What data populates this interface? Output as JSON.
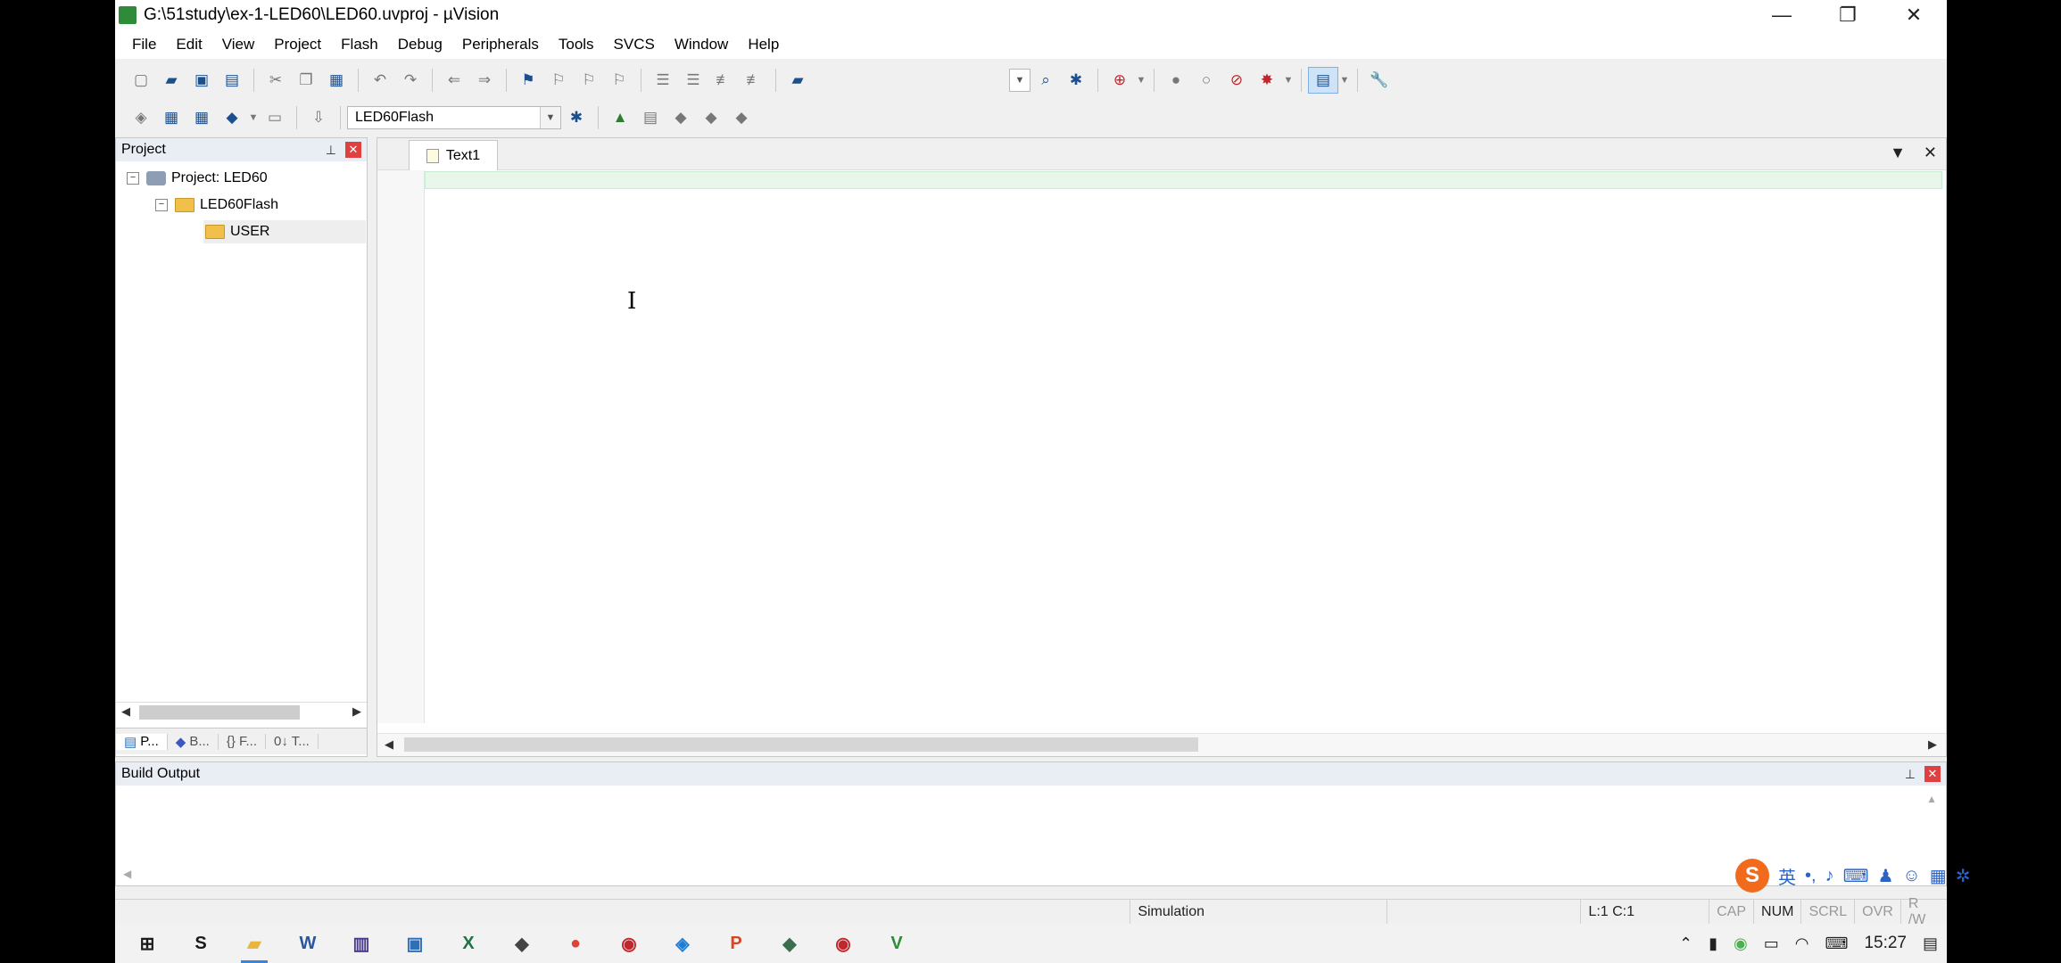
{
  "window": {
    "title": "G:\\51study\\ex-1-LED60\\LED60.uvproj - µVision",
    "controls": {
      "minimize": "—",
      "restore": "❐",
      "close": "✕"
    }
  },
  "menu": [
    "File",
    "Edit",
    "View",
    "Project",
    "Flash",
    "Debug",
    "Peripherals",
    "Tools",
    "SVCS",
    "Window",
    "Help"
  ],
  "toolbar2": {
    "target_select": "LED60Flash"
  },
  "project_panel": {
    "title": "Project",
    "tree": {
      "project": "Project: LED60",
      "target": "LED60Flash",
      "group": "USER"
    },
    "tabs": [
      "P...",
      "B...",
      "{} F...",
      "0↓ T..."
    ]
  },
  "editor": {
    "tabs": [
      {
        "label": "Text1"
      }
    ]
  },
  "build_output": {
    "title": "Build Output"
  },
  "status_bar": {
    "mode": "Simulation",
    "position": "L:1 C:1",
    "indicators": [
      "CAP",
      "NUM",
      "SCRL",
      "OVR",
      "R /W"
    ]
  },
  "ime": {
    "logo": "S",
    "lang": "英"
  },
  "taskbar": {
    "apps": [
      {
        "name": "start",
        "glyph": "⊞",
        "color": "#1a1a1a"
      },
      {
        "name": "app-s",
        "glyph": "S",
        "color": "#1a1a1a"
      },
      {
        "name": "file-explorer",
        "glyph": "▰",
        "color": "#e8b63c"
      },
      {
        "name": "word",
        "glyph": "W",
        "color": "#2b579a"
      },
      {
        "name": "app-books",
        "glyph": "▥",
        "color": "#4a3b8c"
      },
      {
        "name": "app-window",
        "glyph": "▣",
        "color": "#2f6fb8"
      },
      {
        "name": "excel",
        "glyph": "X",
        "color": "#217346"
      },
      {
        "name": "app-book",
        "glyph": "◆",
        "color": "#444"
      },
      {
        "name": "chrome",
        "glyph": "●",
        "color": "#db4437"
      },
      {
        "name": "app-signal",
        "glyph": "◉",
        "color": "#c0262b"
      },
      {
        "name": "app-photos",
        "glyph": "◈",
        "color": "#1e7ed6"
      },
      {
        "name": "powerpoint",
        "glyph": "P",
        "color": "#d24726"
      },
      {
        "name": "app-stack",
        "glyph": "◆",
        "color": "#3b6e4e"
      },
      {
        "name": "app-signal2",
        "glyph": "◉",
        "color": "#c0262b"
      },
      {
        "name": "keil",
        "glyph": "V",
        "color": "#2e8b3a"
      }
    ],
    "clock": "15:27"
  }
}
